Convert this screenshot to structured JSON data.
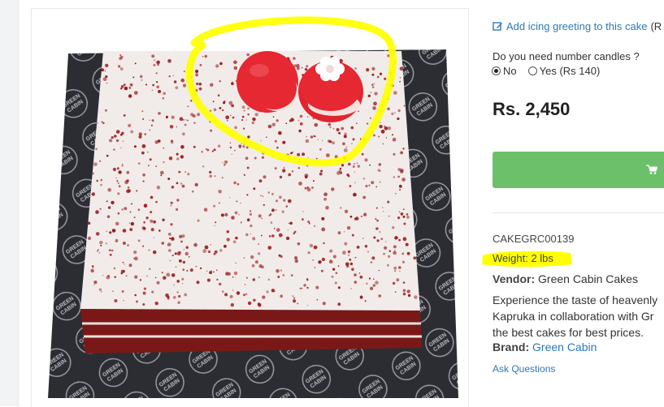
{
  "product": {
    "icing_link": "Add icing greeting to this cake",
    "icing_suffix": "(R",
    "candles_question": "Do you need number candles ?",
    "candle_options": [
      {
        "label": "No",
        "selected": true
      },
      {
        "label": "Yes (Rs 140)",
        "selected": false
      }
    ],
    "price": "Rs. 2,450",
    "cart_button_icon": "shopping-cart-icon",
    "sku": "CAKEGRC00139",
    "weight": "Weight: 2 lbs",
    "vendor_key": "Vendor:",
    "vendor_value": "Green Cabin Cakes",
    "description_lines": [
      "Experience the taste of heavenly",
      "Kapruka in collaboration with Gr",
      "the best cakes for best prices."
    ],
    "brand_key": "Brand:",
    "brand_value": "Green Cabin",
    "ask_questions": "Ask Questions"
  },
  "image": {
    "board_text": "GREEN CABIN"
  },
  "colors": {
    "link": "#2a7ab8",
    "cart_green": "#6cc06a",
    "highlight_yellow": "#ffff00",
    "sprinkle_red": "#9b1b1f"
  }
}
